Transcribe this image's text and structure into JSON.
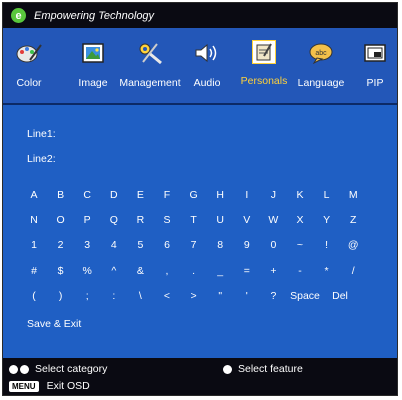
{
  "title_bar": {
    "brand": "Empowering Technology",
    "logo_glyph": "e"
  },
  "categories": [
    {
      "label": "Color",
      "icon": "palette-icon"
    },
    {
      "label": "Image",
      "icon": "image-icon"
    },
    {
      "label": "Management",
      "icon": "tools-icon"
    },
    {
      "label": "Audio",
      "icon": "speaker-icon"
    },
    {
      "label": "Personals",
      "icon": "note-pad-icon",
      "selected": true
    },
    {
      "label": "Language",
      "icon": "abc-bubble-icon"
    },
    {
      "label": "PIP",
      "icon": "pip-window-icon"
    }
  ],
  "fields": {
    "line1": "Line1:",
    "line2": "Line2:"
  },
  "keyboard": [
    [
      "A",
      "B",
      "C",
      "D",
      "E",
      "F",
      "G",
      "H",
      "I",
      "J",
      "K",
      "L",
      "M"
    ],
    [
      "N",
      "O",
      "P",
      "Q",
      "R",
      "S",
      "T",
      "U",
      "V",
      "W",
      "X",
      "Y",
      "Z"
    ],
    [
      "1",
      "2",
      "3",
      "4",
      "5",
      "6",
      "7",
      "8",
      "9",
      "0",
      "~",
      "!",
      "@"
    ],
    [
      "#",
      "$",
      "%",
      "^",
      "&",
      ",",
      ".",
      "_",
      "=",
      "+",
      "-",
      "*",
      "/"
    ],
    [
      "(",
      ")",
      ";",
      ":",
      "\\",
      "<",
      ">",
      "\"",
      "'",
      "?",
      "Space",
      "Del"
    ]
  ],
  "save_exit": "Save  &  Exit",
  "footer": {
    "select_category": "Select category",
    "select_feature": "Select feature",
    "menu_key": "MENU",
    "exit_osd": "Exit OSD"
  },
  "colors": {
    "background": "#1f5fc4",
    "bar": "#0a0a12",
    "selected_label": "#ffd23a",
    "logo": "#59c73c"
  }
}
